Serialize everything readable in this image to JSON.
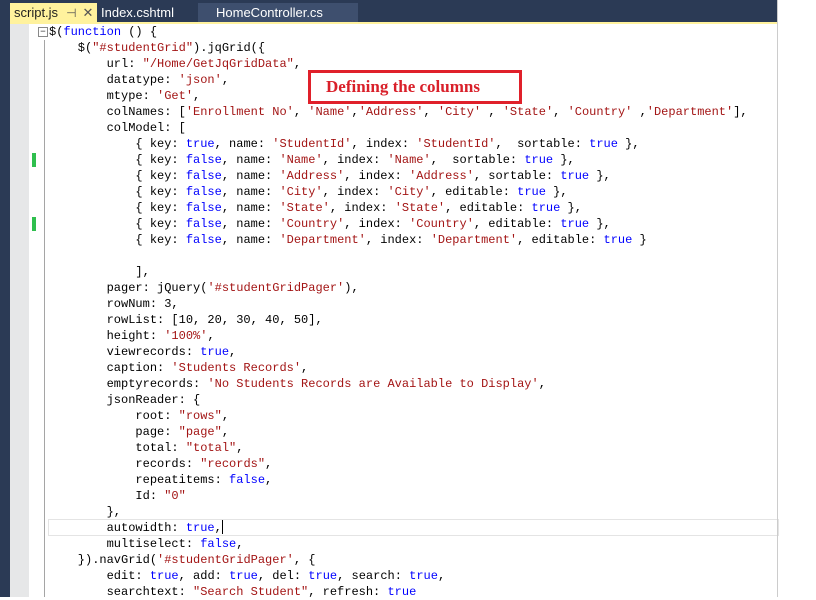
{
  "tabs": [
    {
      "label": "script.js",
      "active": true
    },
    {
      "label": "Index.cshtml",
      "active": false
    },
    {
      "label": "HomeController.cs",
      "active": false
    }
  ],
  "icons": {
    "pin": "pin-icon",
    "close": "close-icon",
    "collapse": "collapse-minus-icon"
  },
  "colors": {
    "keyword": "#0000ff",
    "string": "#a31515",
    "tab_active": "#fff29d",
    "chrome": "#2b3a55",
    "annotation": "#e0202a",
    "change_marker": "#2fbf4e"
  },
  "annotation": {
    "text": "Defining the columns"
  },
  "code_lines": [
    [
      [
        "p",
        "$("
      ],
      [
        "k",
        "function"
      ],
      [
        "p",
        " () {"
      ]
    ],
    [
      [
        "p",
        "    $("
      ],
      [
        "s",
        "\"#studentGrid\""
      ],
      [
        "p",
        ").jqGrid({"
      ]
    ],
    [
      [
        "p",
        "        url: "
      ],
      [
        "s",
        "\"/Home/GetJqGridData\""
      ],
      [
        "p",
        ","
      ]
    ],
    [
      [
        "p",
        "        datatype: "
      ],
      [
        "s",
        "'json'"
      ],
      [
        "p",
        ","
      ]
    ],
    [
      [
        "p",
        "        mtype: "
      ],
      [
        "s",
        "'Get'"
      ],
      [
        "p",
        ","
      ]
    ],
    [
      [
        "p",
        "        colNames: ["
      ],
      [
        "s",
        "'Enrollment No'"
      ],
      [
        "p",
        ", "
      ],
      [
        "s",
        "'Name'"
      ],
      [
        "p",
        ","
      ],
      [
        "s",
        "'Address'"
      ],
      [
        "p",
        ", "
      ],
      [
        "s",
        "'City'"
      ],
      [
        "p",
        " , "
      ],
      [
        "s",
        "'State'"
      ],
      [
        "p",
        ", "
      ],
      [
        "s",
        "'Country'"
      ],
      [
        "p",
        " ,"
      ],
      [
        "s",
        "'Department'"
      ],
      [
        "p",
        "],"
      ]
    ],
    [
      [
        "p",
        "        colModel: ["
      ]
    ],
    [
      [
        "p",
        "            { key: "
      ],
      [
        "k",
        "true"
      ],
      [
        "p",
        ", name: "
      ],
      [
        "s",
        "'StudentId'"
      ],
      [
        "p",
        ", index: "
      ],
      [
        "s",
        "'StudentId'"
      ],
      [
        "p",
        ",  sortable: "
      ],
      [
        "k",
        "true"
      ],
      [
        "p",
        " },"
      ]
    ],
    [
      [
        "p",
        "            { key: "
      ],
      [
        "k",
        "false"
      ],
      [
        "p",
        ", name: "
      ],
      [
        "s",
        "'Name'"
      ],
      [
        "p",
        ", index: "
      ],
      [
        "s",
        "'Name'"
      ],
      [
        "p",
        ",  sortable: "
      ],
      [
        "k",
        "true"
      ],
      [
        "p",
        " },"
      ]
    ],
    [
      [
        "p",
        "            { key: "
      ],
      [
        "k",
        "false"
      ],
      [
        "p",
        ", name: "
      ],
      [
        "s",
        "'Address'"
      ],
      [
        "p",
        ", index: "
      ],
      [
        "s",
        "'Address'"
      ],
      [
        "p",
        ", sortable: "
      ],
      [
        "k",
        "true"
      ],
      [
        "p",
        " },"
      ]
    ],
    [
      [
        "p",
        "            { key: "
      ],
      [
        "k",
        "false"
      ],
      [
        "p",
        ", name: "
      ],
      [
        "s",
        "'City'"
      ],
      [
        "p",
        ", index: "
      ],
      [
        "s",
        "'City'"
      ],
      [
        "p",
        ", editable: "
      ],
      [
        "k",
        "true"
      ],
      [
        "p",
        " },"
      ]
    ],
    [
      [
        "p",
        "            { key: "
      ],
      [
        "k",
        "false"
      ],
      [
        "p",
        ", name: "
      ],
      [
        "s",
        "'State'"
      ],
      [
        "p",
        ", index: "
      ],
      [
        "s",
        "'State'"
      ],
      [
        "p",
        ", editable: "
      ],
      [
        "k",
        "true"
      ],
      [
        "p",
        " },"
      ]
    ],
    [
      [
        "p",
        "            { key: "
      ],
      [
        "k",
        "false"
      ],
      [
        "p",
        ", name: "
      ],
      [
        "s",
        "'Country'"
      ],
      [
        "p",
        ", index: "
      ],
      [
        "s",
        "'Country'"
      ],
      [
        "p",
        ", editable: "
      ],
      [
        "k",
        "true"
      ],
      [
        "p",
        " },"
      ]
    ],
    [
      [
        "p",
        "            { key: "
      ],
      [
        "k",
        "false"
      ],
      [
        "p",
        ", name: "
      ],
      [
        "s",
        "'Department'"
      ],
      [
        "p",
        ", index: "
      ],
      [
        "s",
        "'Department'"
      ],
      [
        "p",
        ", editable: "
      ],
      [
        "k",
        "true"
      ],
      [
        "p",
        " }"
      ]
    ],
    [
      [
        "p",
        ""
      ]
    ],
    [
      [
        "p",
        "            ],"
      ]
    ],
    [
      [
        "p",
        "        pager: jQuery("
      ],
      [
        "s",
        "'#studentGridPager'"
      ],
      [
        "p",
        "),"
      ]
    ],
    [
      [
        "p",
        "        rowNum: 3,"
      ]
    ],
    [
      [
        "p",
        "        rowList: [10, 20, 30, 40, 50],"
      ]
    ],
    [
      [
        "p",
        "        height: "
      ],
      [
        "s",
        "'100%'"
      ],
      [
        "p",
        ","
      ]
    ],
    [
      [
        "p",
        "        viewrecords: "
      ],
      [
        "k",
        "true"
      ],
      [
        "p",
        ","
      ]
    ],
    [
      [
        "p",
        "        caption: "
      ],
      [
        "s",
        "'Students Records'"
      ],
      [
        "p",
        ","
      ]
    ],
    [
      [
        "p",
        "        emptyrecords: "
      ],
      [
        "s",
        "'No Students Records are Available to Display'"
      ],
      [
        "p",
        ","
      ]
    ],
    [
      [
        "p",
        "        jsonReader: {"
      ]
    ],
    [
      [
        "p",
        "            root: "
      ],
      [
        "s",
        "\"rows\""
      ],
      [
        "p",
        ","
      ]
    ],
    [
      [
        "p",
        "            page: "
      ],
      [
        "s",
        "\"page\""
      ],
      [
        "p",
        ","
      ]
    ],
    [
      [
        "p",
        "            total: "
      ],
      [
        "s",
        "\"total\""
      ],
      [
        "p",
        ","
      ]
    ],
    [
      [
        "p",
        "            records: "
      ],
      [
        "s",
        "\"records\""
      ],
      [
        "p",
        ","
      ]
    ],
    [
      [
        "p",
        "            repeatitems: "
      ],
      [
        "k",
        "false"
      ],
      [
        "p",
        ","
      ]
    ],
    [
      [
        "p",
        "            Id: "
      ],
      [
        "s",
        "\"0\""
      ]
    ],
    [
      [
        "p",
        "        },"
      ]
    ],
    [
      [
        "p",
        "        autowidth: "
      ],
      [
        "k",
        "true"
      ],
      [
        "p",
        ","
      ]
    ],
    [
      [
        "p",
        "        multiselect: "
      ],
      [
        "k",
        "false"
      ],
      [
        "p",
        ","
      ]
    ],
    [
      [
        "p",
        "    }).navGrid("
      ],
      [
        "s",
        "'#studentGridPager'"
      ],
      [
        "p",
        ", {"
      ]
    ],
    [
      [
        "p",
        "        edit: "
      ],
      [
        "k",
        "true"
      ],
      [
        "p",
        ", add: "
      ],
      [
        "k",
        "true"
      ],
      [
        "p",
        ", del: "
      ],
      [
        "k",
        "true"
      ],
      [
        "p",
        ", search: "
      ],
      [
        "k",
        "true"
      ],
      [
        "p",
        ","
      ]
    ],
    [
      [
        "p",
        "        searchtext: "
      ],
      [
        "s",
        "\"Search Student\""
      ],
      [
        "p",
        ", refresh: "
      ],
      [
        "k",
        "true"
      ]
    ]
  ],
  "cursor_line": 32,
  "changed_lines": [
    9,
    13
  ]
}
